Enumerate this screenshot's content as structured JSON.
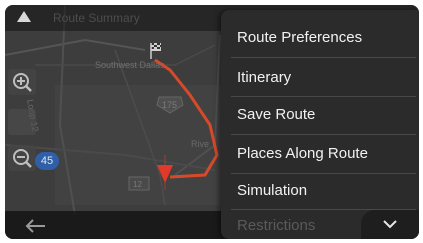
{
  "topbar": {
    "title": "Route Summary"
  },
  "map": {
    "labels": {
      "place": "Southwest Dallas",
      "road_west": "Loop 12",
      "road_shield": "175",
      "road_south": "12",
      "road_east": "Rive"
    },
    "badge": "45"
  },
  "menu": {
    "items": [
      {
        "label": "Route Preferences"
      },
      {
        "label": "Itinerary"
      },
      {
        "label": "Save Route"
      },
      {
        "label": "Places Along Route"
      },
      {
        "label": "Simulation"
      },
      {
        "label": "Restrictions"
      }
    ]
  },
  "colors": {
    "route": "#d64a2a",
    "position_marker": "#e23a2a",
    "map_bg": "#3b3b3b"
  }
}
